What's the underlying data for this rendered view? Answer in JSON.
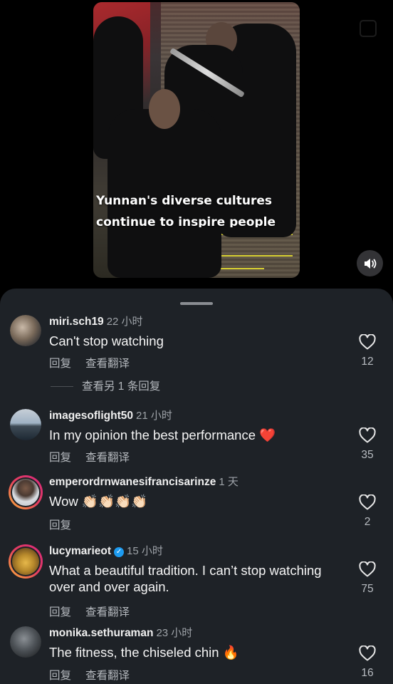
{
  "video": {
    "caption": "Yunnan's diverse cultures continue to inspire people"
  },
  "comments": [
    {
      "username": "miri.sch19",
      "time": "22 小时",
      "text": "Can't stop watching",
      "reply_label": "回复",
      "translate_label": "查看翻译",
      "likes": "12",
      "view_replies": "查看另 1 条回复"
    },
    {
      "username": "imagesoflight50",
      "time": "21 小时",
      "text": "In my opinion the best performance ❤️",
      "reply_label": "回复",
      "translate_label": "查看翻译",
      "likes": "35"
    },
    {
      "username": "emperordrnwanesifrancisarinze",
      "time": "1 天",
      "text": "Wow 👏🏻👏🏻👏🏻👏🏻",
      "reply_label": "回复",
      "likes": "2"
    },
    {
      "username": "lucymarieot",
      "time": "15 小时",
      "text": "What a beautiful tradition. I can’t stop watching over and over again.",
      "reply_label": "回复",
      "translate_label": "查看翻译",
      "likes": "75"
    },
    {
      "username": "monika.sethuraman",
      "time": "23 小时",
      "text": "The fitness, the chiseled chin 🔥",
      "reply_label": "回复",
      "translate_label": "查看翻译",
      "likes": "16"
    }
  ],
  "icons": {
    "like": "heart-outline-icon",
    "sound": "speaker-icon",
    "verified": "verified-badge-icon"
  },
  "colors": {
    "sheet_bg": "#1e2227",
    "verified_blue": "#1d9bf0",
    "story_ring_start": "#fdb338",
    "story_ring_end": "#d8287e"
  }
}
